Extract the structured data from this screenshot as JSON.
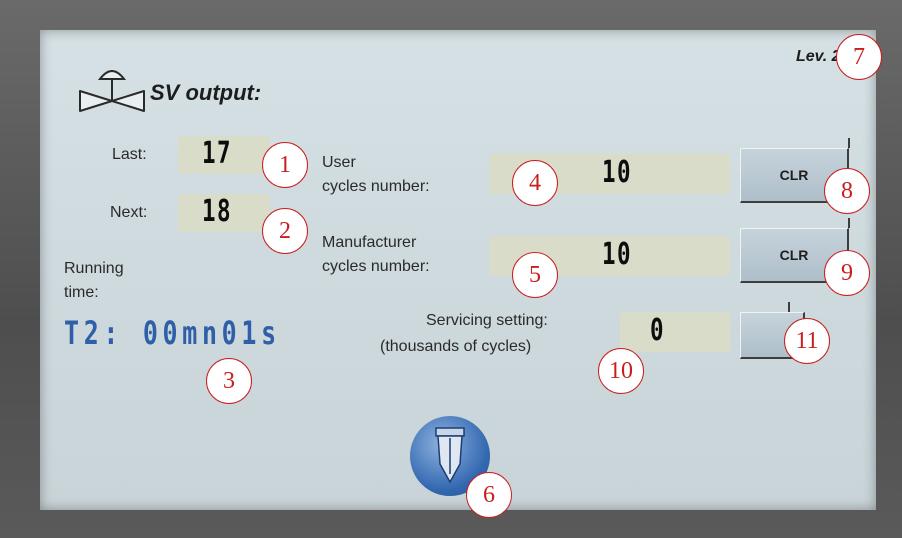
{
  "header": {
    "level_label": "Lev. 2",
    "title": "SV output:",
    "valve_icon": "valve-icon"
  },
  "cycles": {
    "last_label": "Last:",
    "last_value": "17",
    "next_label": "Next:",
    "next_value": "18"
  },
  "running": {
    "label_line1": "Running",
    "label_line2": "time:",
    "value": "T2: 00mn01s"
  },
  "user_cycles": {
    "label_line1": "User",
    "label_line2": "cycles number:",
    "value": "10",
    "clr_label": "CLR"
  },
  "manufacturer_cycles": {
    "label_line1": "Manufacturer",
    "label_line2": "cycles number:",
    "value": "10",
    "clr_label": "CLR"
  },
  "servicing": {
    "label_line1": "Servicing setting:",
    "label_line2": "(thousands of cycles)",
    "value": "0"
  },
  "home_button_icon": "nozzle-icon",
  "callouts": [
    "1",
    "2",
    "3",
    "4",
    "5",
    "6",
    "7",
    "8",
    "9",
    "10",
    "11"
  ],
  "colors": {
    "screen": "#cfdbdf",
    "running_time": "#2f5fa8",
    "callout": "#c81e1e",
    "bezel": "#5b5b5b"
  }
}
